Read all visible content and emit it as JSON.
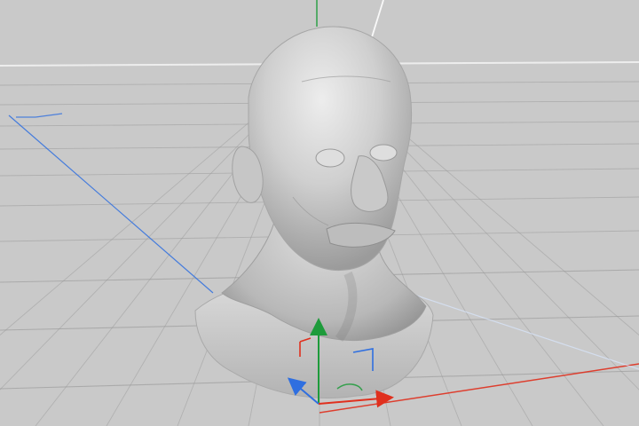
{
  "viewport": {
    "background_color": "#c9c9c9",
    "grid_color": "#9a9a9a",
    "horizon_color": "#f2f2f2",
    "axis_colors": {
      "x": "#e0301e",
      "y": "#1e9b3b",
      "z": "#2f6fe0"
    },
    "model": {
      "name": "",
      "shade_light": "#e7e7e7",
      "shade_mid": "#bdbdbd",
      "shade_dark": "#7f7f7f"
    }
  }
}
